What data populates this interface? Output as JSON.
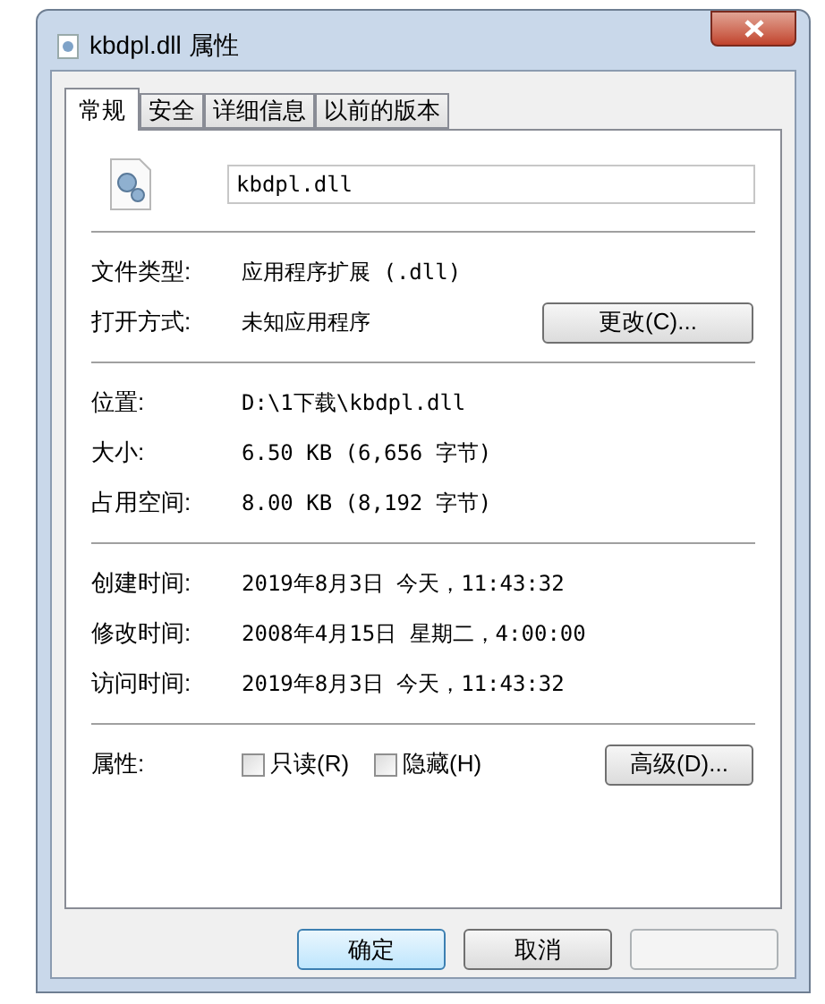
{
  "window": {
    "title": "kbdpl.dll 属性"
  },
  "tabs": [
    {
      "label": "常规",
      "selected": true
    },
    {
      "label": "安全",
      "selected": false
    },
    {
      "label": "详细信息",
      "selected": false
    },
    {
      "label": "以前的版本",
      "selected": false
    }
  ],
  "file_name": {
    "value": "kbdpl.dll"
  },
  "groups": [
    [
      {
        "label": "文件类型:",
        "value": "应用程序扩展 (.dll)"
      },
      {
        "label": "打开方式:",
        "value": "未知应用程序",
        "button": "更改(C)..."
      }
    ],
    [
      {
        "label": "位置:",
        "value": "D:\\1下载\\kbdpl.dll"
      },
      {
        "label": "大小:",
        "value": "6.50 KB (6,656 字节)"
      },
      {
        "label": "占用空间:",
        "value": "8.00 KB (8,192 字节)"
      }
    ],
    [
      {
        "label": "创建时间:",
        "value": "2019年8月3日 今天，11:43:32"
      },
      {
        "label": "修改时间:",
        "value": "2008年4月15日 星期二，4:00:00"
      },
      {
        "label": "访问时间:",
        "value": "2019年8月3日 今天，11:43:32"
      }
    ]
  ],
  "attributes": {
    "label": "属性:",
    "checkboxes": [
      {
        "label": "只读(R)",
        "checked": false
      },
      {
        "label": "隐藏(H)",
        "checked": false
      }
    ],
    "button": "高级(D)..."
  },
  "footer_buttons": [
    {
      "label": "确定",
      "default": true,
      "disabled": false
    },
    {
      "label": "取消",
      "default": false,
      "disabled": false
    },
    {
      "default": false,
      "disabled": true
    }
  ]
}
